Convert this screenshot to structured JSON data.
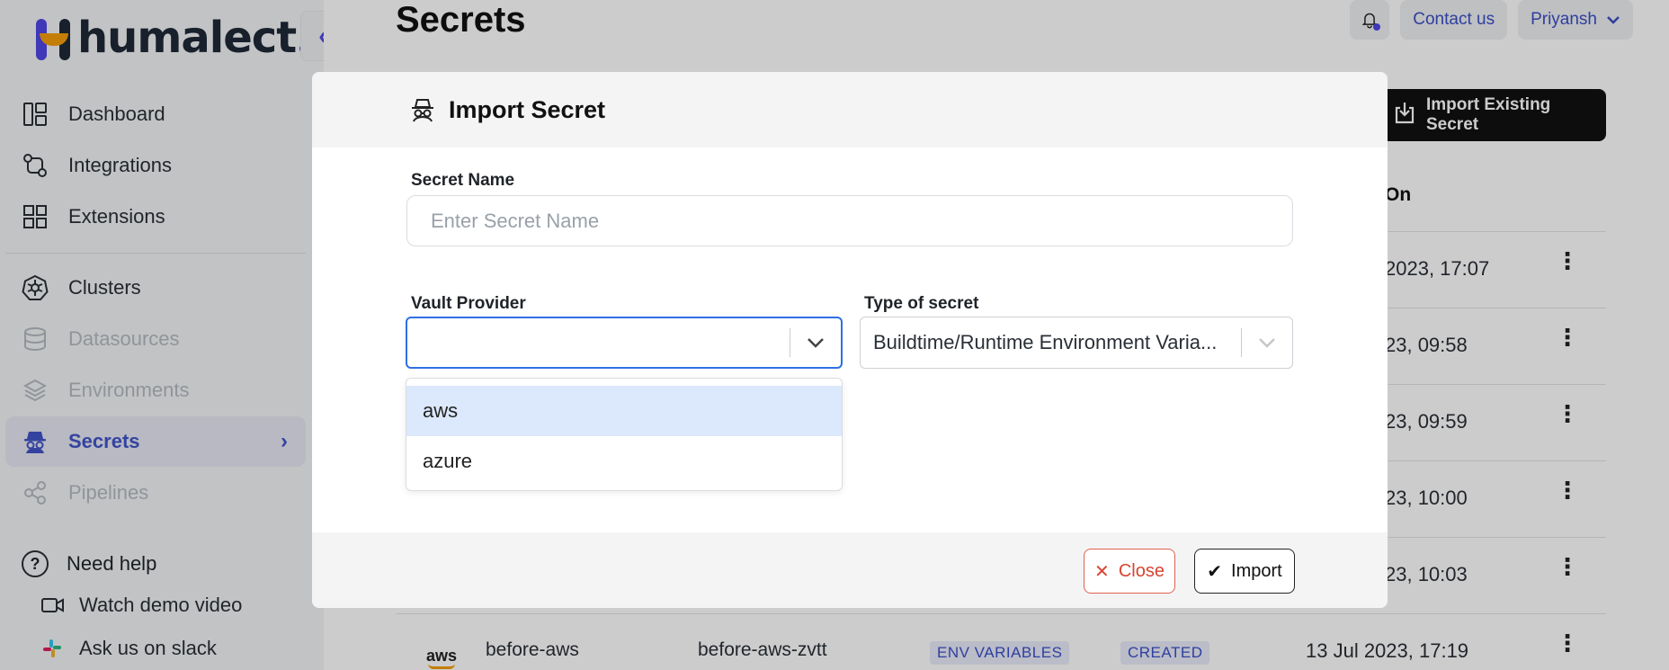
{
  "app": {
    "logo_text": "humalect"
  },
  "sidebar": {
    "items": [
      {
        "label": "Dashboard",
        "icon": "dashboard-icon"
      },
      {
        "label": "Integrations",
        "icon": "integrations-icon"
      },
      {
        "label": "Extensions",
        "icon": "extensions-icon"
      },
      {
        "label": "Clusters",
        "icon": "kubernetes-icon"
      },
      {
        "label": "Datasources",
        "icon": "database-icon"
      },
      {
        "label": "Environments",
        "icon": "layers-icon"
      },
      {
        "label": "Secrets",
        "icon": "spy-icon"
      },
      {
        "label": "Pipelines",
        "icon": "share-icon"
      }
    ],
    "help": {
      "label": "Need help",
      "demo": "Watch demo video",
      "slack": "Ask us on slack"
    }
  },
  "header": {
    "title": "Secrets",
    "contact": "Contact us",
    "user": "Priyansh"
  },
  "toolbar": {
    "import_existing": "Import Existing Secret"
  },
  "table": {
    "partial_header": "On",
    "rows": [
      {
        "date": "2023, 17:07"
      },
      {
        "date": "23, 09:58"
      },
      {
        "date": "23, 09:59"
      },
      {
        "date": "23, 10:00"
      },
      {
        "date": "23, 10:03"
      },
      {
        "provider": "aws",
        "name": "before-aws",
        "id": "before-aws-zvtt",
        "type": "ENV VARIABLES",
        "status": "CREATED",
        "date": "13 Jul 2023, 17:19"
      }
    ]
  },
  "modal": {
    "title": "Import Secret",
    "secret_name_label": "Secret Name",
    "secret_name_placeholder": "Enter Secret Name",
    "vault_label": "Vault Provider",
    "vault_value": "",
    "vault_options": [
      "aws",
      "azure"
    ],
    "type_label": "Type of secret",
    "type_value": "Buildtime/Runtime Environment Varia...",
    "close_label": "Close",
    "import_label": "Import"
  },
  "colors": {
    "accent": "#4154c9",
    "focus": "#2f6fe4",
    "danger": "#d64532"
  }
}
